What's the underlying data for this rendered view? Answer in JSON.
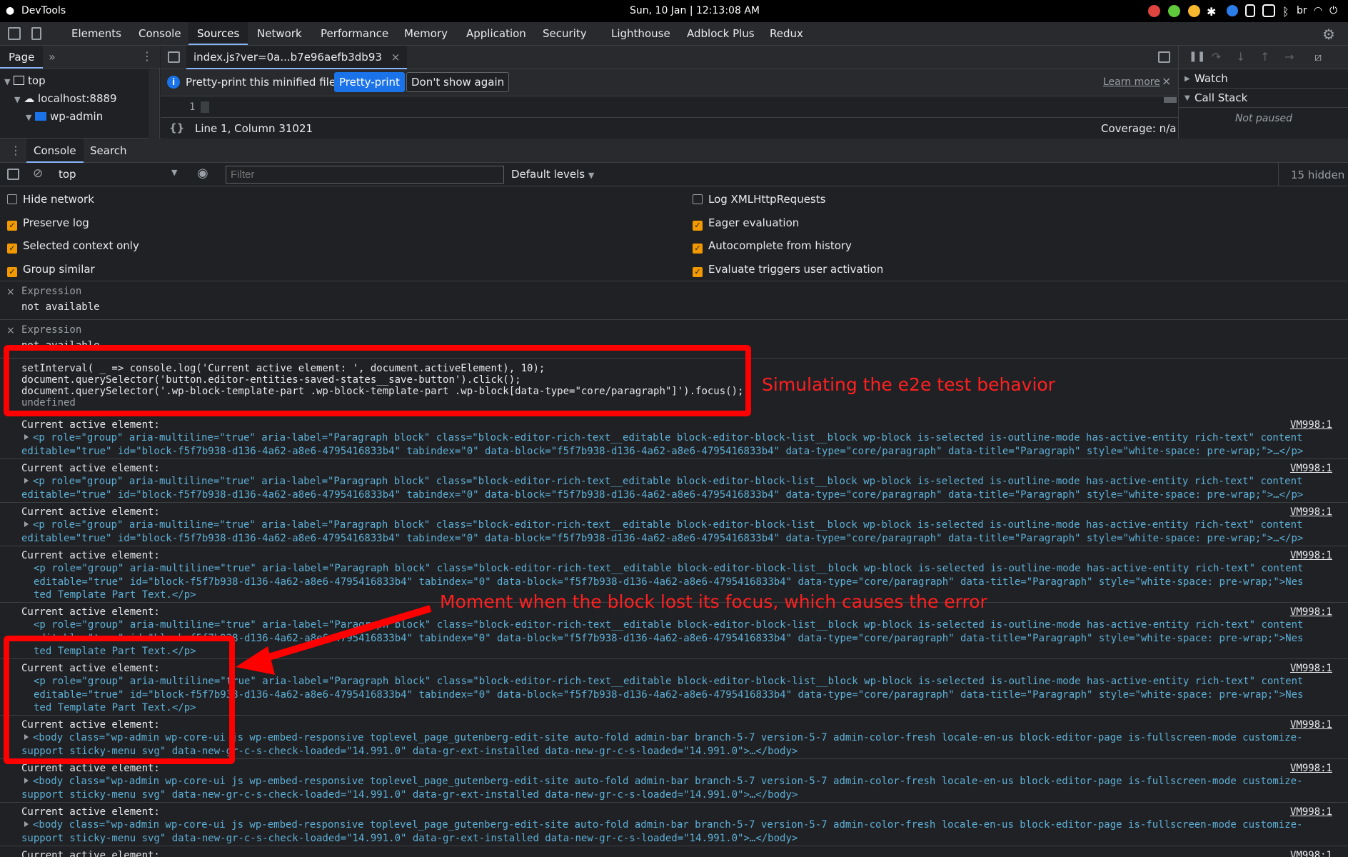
{
  "system_bar": {
    "app_name": "DevTools",
    "clock": "Sun, 10 Jan | 12:13:08 AM",
    "lang": "br"
  },
  "main_tabs": [
    "Elements",
    "Console",
    "Sources",
    "Network",
    "Performance",
    "Memory",
    "Application",
    "Security",
    "Lighthouse",
    "Adblock Plus",
    "Redux"
  ],
  "active_main_tab": "Sources",
  "navigator": {
    "tab": "Page",
    "items": [
      "top",
      "localhost:8889",
      "wp-admin"
    ]
  },
  "editor": {
    "file_tab": "index.js?ver=0a...b7e96aefb3db93",
    "info_text": "Pretty-print this minified file?",
    "pretty_print_btn": "Pretty-print",
    "dont_show_btn": "Don't show again",
    "learn_more": "Learn more",
    "line_number": "1",
    "position": "Line 1, Column 31021",
    "coverage": "Coverage: n/a",
    "format_glyph": "{}"
  },
  "debugger": {
    "watch": "Watch",
    "call_stack": "Call Stack",
    "not_paused": "Not paused"
  },
  "drawer": {
    "tabs": [
      "Console",
      "Search"
    ],
    "context": "top",
    "filter_placeholder": "Filter",
    "levels": "Default levels",
    "hidden": "15 hidden"
  },
  "settings_left": [
    {
      "label": "Hide network",
      "checked": false
    },
    {
      "label": "Preserve log",
      "checked": true
    },
    {
      "label": "Selected context only",
      "checked": true
    },
    {
      "label": "Group similar",
      "checked": true
    }
  ],
  "settings_right": [
    {
      "label": "Log XMLHttpRequests",
      "checked": false
    },
    {
      "label": "Eager evaluation",
      "checked": true
    },
    {
      "label": "Autocomplete from history",
      "checked": true
    },
    {
      "label": "Evaluate triggers user activation",
      "checked": true
    }
  ],
  "expressions": [
    {
      "label": "Expression",
      "value": "not available"
    },
    {
      "label": "Expression",
      "value": "not available"
    }
  ],
  "input_code": [
    "setInterval( _ => console.log('Current active element: ', document.activeElement), 10);",
    "document.querySelector('button.editor-entities-saved-states__save-button').click();",
    "document.querySelector('.wp-block-template-part .wp-block-template-part .wp-block[data-type=\"core/paragraph\"]').focus();"
  ],
  "undefined_text": "undefined",
  "log_label": "Current active element:",
  "log_source": "VM998:1",
  "p_collapsed": "<p role=\"group\" aria-multiline=\"true\" aria-label=\"Paragraph block\" class=\"block-editor-rich-text__editable block-editor-block-list__block wp-block is-selected is-outline-mode has-active-entity rich-text\" contenteditable=\"true\" id=\"block-f5f7b938-d136-4a62-a8e6-4795416833b4\" tabindex=\"0\" data-block=\"f5f7b938-d136-4a62-a8e6-4795416833b4\" data-type=\"core/paragraph\" data-title=\"Paragraph\" style=\"white-space: pre-wrap;\">…</p>",
  "p_expanded": "<p role=\"group\" aria-multiline=\"true\" aria-label=\"Paragraph block\" class=\"block-editor-rich-text__editable block-editor-block-list__block wp-block is-selected is-outline-mode has-active-entity rich-text\" contenteditable=\"true\" id=\"block-f5f7b938-d136-4a62-a8e6-4795416833b4\" tabindex=\"0\" data-block=\"f5f7b938-d136-4a62-a8e6-4795416833b4\" data-type=\"core/paragraph\" data-title=\"Paragraph\" style=\"white-space: pre-wrap;\">Nested Template Part Text.</p>",
  "body_collapsed": "<body class=\"wp-admin wp-core-ui js wp-embed-responsive toplevel_page_gutenberg-edit-site auto-fold admin-bar branch-5-7 version-5-7 admin-color-fresh locale-en-us block-editor-page is-fullscreen-mode customize-support sticky-menu svg\" data-new-gr-c-s-check-loaded=\"14.991.0\" data-gr-ext-installed data-new-gr-c-s-loaded=\"14.991.0\">…</body>",
  "annotations": {
    "top": "Simulating the e2e test behavior",
    "bottom": "Moment when the block lost its focus, which causes the error"
  },
  "colors": {
    "accent": "#8ab4f8",
    "annotation": "#ff0000",
    "checkbox": "#f29900"
  }
}
